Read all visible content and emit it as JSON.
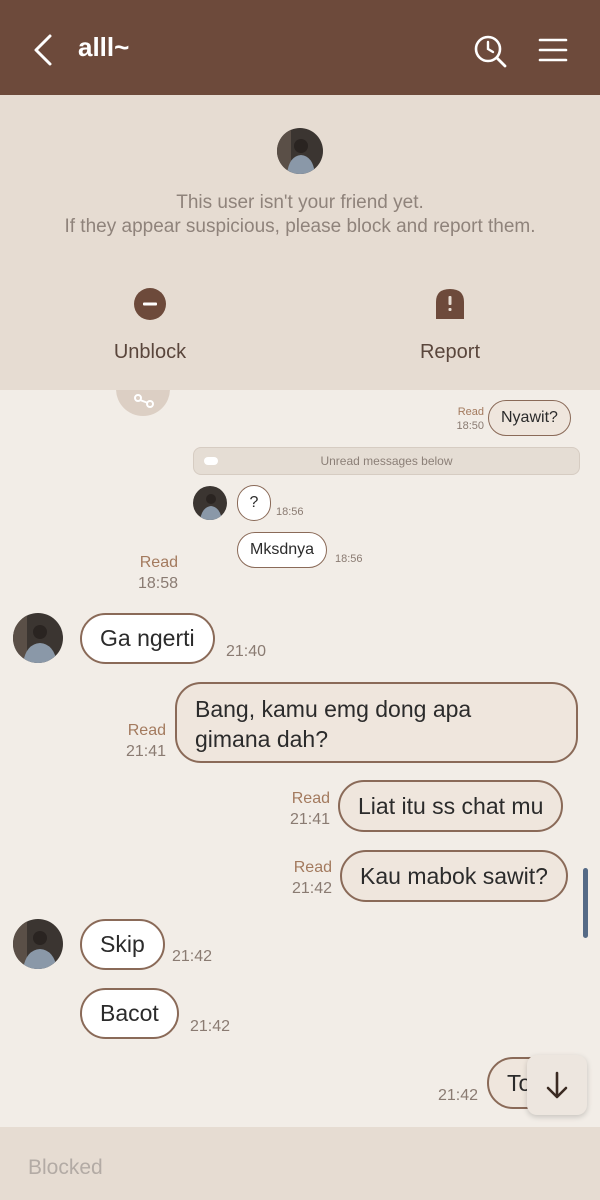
{
  "header": {
    "title": "alll~",
    "back_icon": "chevron-left-icon",
    "search_icon": "search-clock-icon",
    "menu_icon": "hamburger-menu-icon",
    "background": "#6d4a3b"
  },
  "notice": {
    "line1": "This user isn't your friend yet.",
    "line2": "If they appear suspicious, please block and report them.",
    "unblock_label": "Unblock",
    "report_label": "Report"
  },
  "chat": {
    "unread_label": "Unread messages below",
    "messages": [
      {
        "id": "m1",
        "side": "out",
        "text": "Nyawit?",
        "read": "Read",
        "time": "18:50"
      },
      {
        "id": "m2",
        "side": "in",
        "text": "?",
        "time": "18:56"
      },
      {
        "id": "m3",
        "side": "in",
        "text": "Mksdnya",
        "time": "18:56"
      },
      {
        "id": "m4",
        "side": "out",
        "text": "",
        "read": "Read",
        "time": "18:58"
      },
      {
        "id": "m5",
        "side": "in",
        "text": "Ga ngerti",
        "time": "21:40"
      },
      {
        "id": "m6",
        "side": "out",
        "text_line1": "Bang, kamu emg dong apa",
        "text_line2": "gimana dah?",
        "read": "Read",
        "time": "21:41"
      },
      {
        "id": "m7",
        "side": "out",
        "text": "Liat itu ss chat mu",
        "read": "Read",
        "time": "21:41"
      },
      {
        "id": "m8",
        "side": "out",
        "text": "Kau mabok sawit?",
        "read": "Read",
        "time": "21:42"
      },
      {
        "id": "m9",
        "side": "in",
        "text": "Skip",
        "time": "21:42"
      },
      {
        "id": "m10",
        "side": "in",
        "text": "Bacot",
        "time": "21:42"
      },
      {
        "id": "m11",
        "side": "out",
        "text": "To",
        "time": "21:42"
      }
    ]
  },
  "input": {
    "placeholder": "Blocked"
  },
  "colors": {
    "brand": "#6d4a3b",
    "panel": "#e6dcd2",
    "chat_bg": "#f2ede7",
    "bubble_border": "#8a6a58"
  }
}
